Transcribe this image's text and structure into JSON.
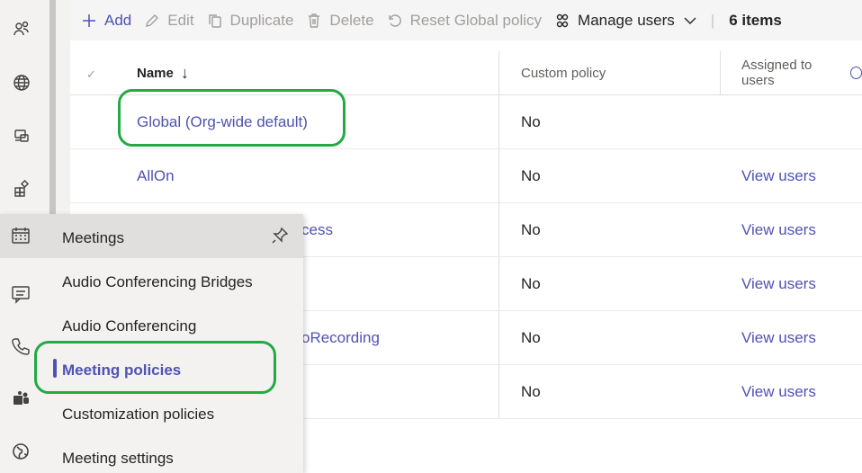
{
  "toolbar": {
    "add": "Add",
    "edit": "Edit",
    "duplicate": "Duplicate",
    "delete": "Delete",
    "reset": "Reset Global policy",
    "manage": "Manage users",
    "count": "6 items"
  },
  "table": {
    "headers": {
      "name": "Name",
      "sort_indicator": "↓",
      "custom": "Custom policy",
      "assigned": "Assigned to users"
    },
    "rows": [
      {
        "name": "Global (Org-wide default)",
        "custom": "No",
        "assigned": ""
      },
      {
        "name": "AllOn",
        "custom": "No",
        "assigned": "View users"
      },
      {
        "name": "cess",
        "custom": "No",
        "assigned": "View users"
      },
      {
        "name": "",
        "custom": "No",
        "assigned": "View users"
      },
      {
        "name": "oRecording",
        "custom": "No",
        "assigned": "View users"
      },
      {
        "name": "",
        "custom": "No",
        "assigned": "View users"
      }
    ]
  },
  "flyout": {
    "title": "Meetings",
    "items": [
      "Audio Conferencing Bridges",
      "Audio Conferencing",
      "Meeting policies",
      "Customization policies",
      "Meeting settings"
    ],
    "active_item": "Meeting policies"
  },
  "colors": {
    "accent": "#4f52b2",
    "highlight_ring": "#22aa44"
  },
  "icons": [
    "users-icon",
    "globe-icon",
    "devices-icon",
    "apps-icon",
    "calendar-icon",
    "chat-icon",
    "phone-icon",
    "teams-icon",
    "planet-icon",
    "pin-icon"
  ]
}
